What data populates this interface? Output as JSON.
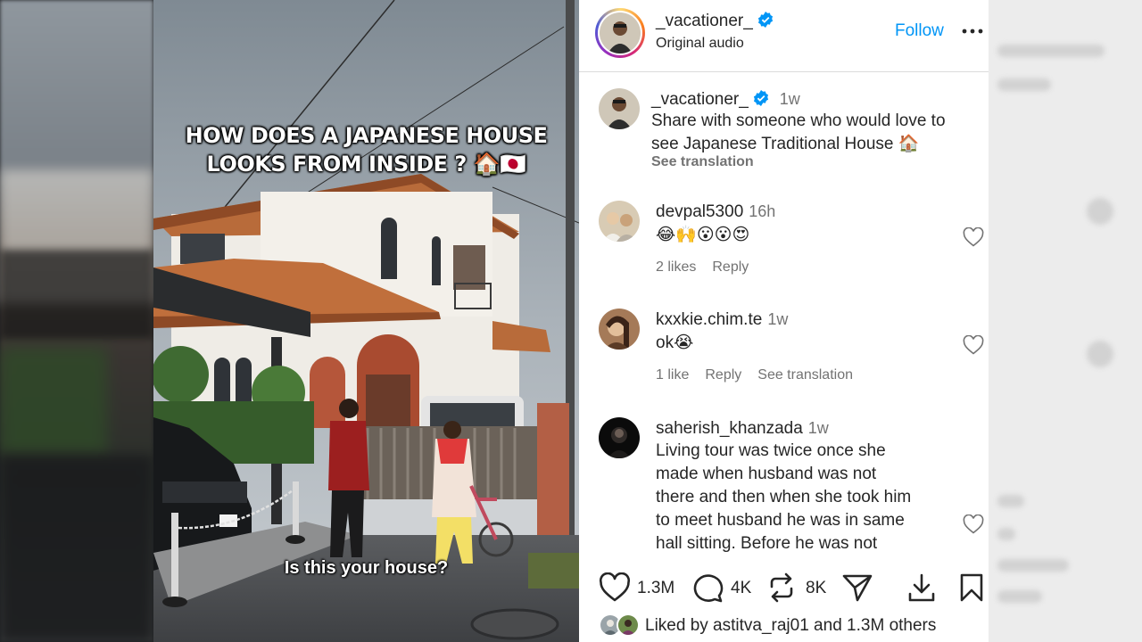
{
  "video": {
    "caption_line1": "HOW DOES A JAPANESE HOUSE",
    "caption_line2": "LOOKS FROM INSIDE ? 🏠🇯🇵",
    "subtitle": "Is this your house?"
  },
  "header": {
    "username": "_vacationer_",
    "audio": "Original audio",
    "follow_label": "Follow"
  },
  "post": {
    "username": "_vacationer_",
    "time": "1w",
    "caption_line1": "Share with someone who would love to",
    "caption_line2": "see Japanese Traditional House 🏠",
    "translate_label": "See translation"
  },
  "comments": [
    {
      "username": "devpal5300",
      "time": "16h",
      "text": "😂🙌😮😮😍",
      "likes": "2 likes",
      "reply": "Reply"
    },
    {
      "username": "kxxkie.chim.te",
      "time": "1w",
      "text": "ok😭",
      "likes": "1 like",
      "reply": "Reply",
      "translate": "See translation"
    },
    {
      "username": "saherish_khanzada",
      "time": "1w",
      "lines": [
        "Living tour was twice once she",
        "made when husband was not",
        "there and then when she took him",
        "to meet husband he was in same",
        "hall sitting. Before he was not"
      ]
    }
  ],
  "stats": {
    "likes": "1.3M",
    "comments": "4K",
    "reposts": "8K"
  },
  "liked_by": {
    "prefix": "Liked by ",
    "user": "astitva_raj01",
    "middle": " and ",
    "others": "1.3M others"
  },
  "colors": {
    "accent": "#0095f6",
    "text": "#262626",
    "secondary": "#737373",
    "verified": "#0095f6"
  }
}
